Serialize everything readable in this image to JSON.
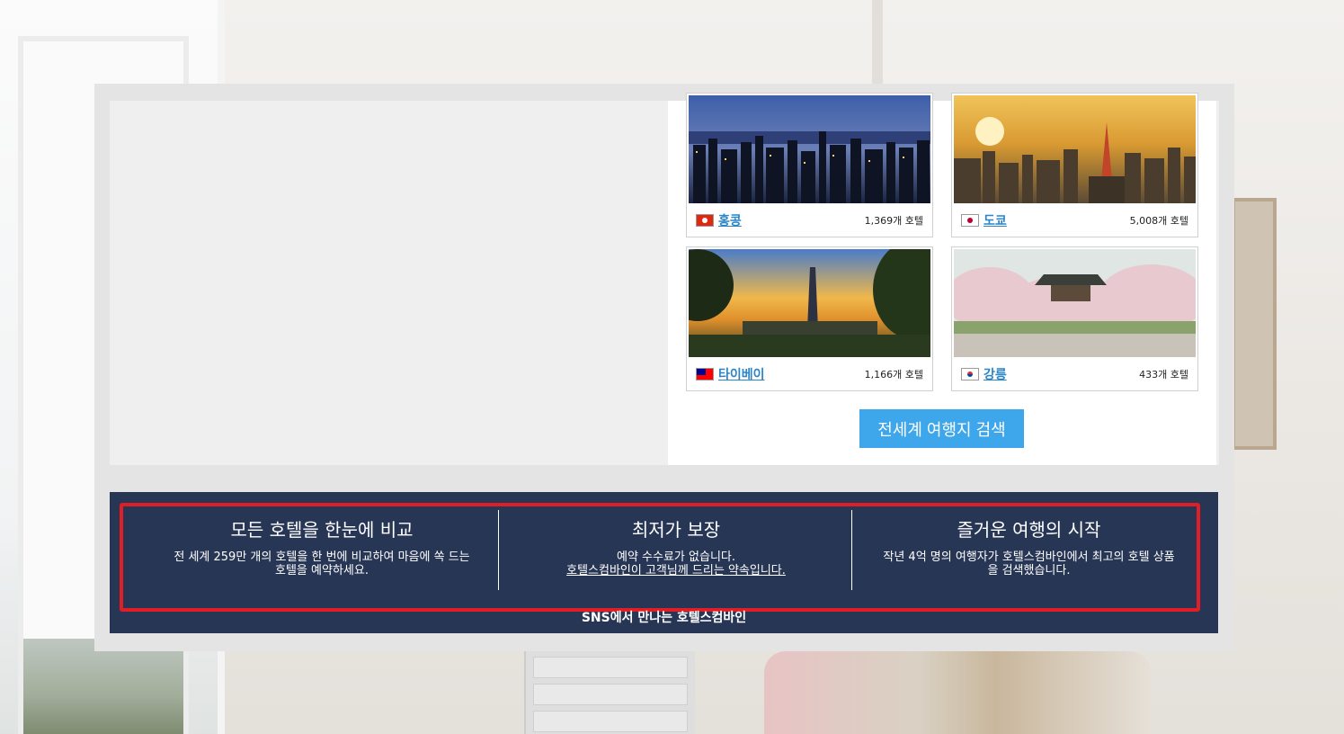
{
  "destinations": [
    {
      "city": "홍콩",
      "count": "1,369개 호텔",
      "flag": "hk-flag-icon"
    },
    {
      "city": "도쿄",
      "count": "5,008개 호텔",
      "flag": "jp-flag-icon"
    },
    {
      "city": "타이베이",
      "count": "1,166개 호텔",
      "flag": "tw-flag-icon"
    },
    {
      "city": "강릉",
      "count": "433개 호텔",
      "flag": "kr-flag-icon"
    }
  ],
  "search_button": "전세계 여행지 검색",
  "features": [
    {
      "title": "모든 호텔을 한눈에 비교",
      "line1": "전 세계 259만 개의 호텔을 한 번에 비교하여 마음에 쏙 드는",
      "line2": "호텔을 예약하세요."
    },
    {
      "title": "최저가 보장",
      "line1": "예약 수수료가 없습니다.",
      "line2": "호텔스컴바인이 고객님께 드리는 약속입니다."
    },
    {
      "title": "즐거운 여행의 시작",
      "line1": "작년 4억 명의 여행자가 호텔스컴바인에서 최고의 호텔 상품",
      "line2": "을 검색했습니다."
    }
  ],
  "sns_text": "SNS에서 만나는 호텔스컴바인",
  "colors": {
    "banner": "#283655",
    "highlight": "#e11d25",
    "link": "#2a85c9",
    "button": "#3ea6ea"
  }
}
